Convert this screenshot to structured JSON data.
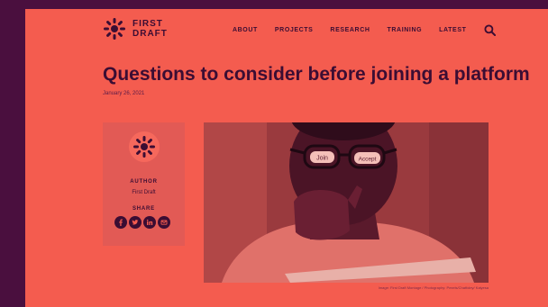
{
  "brand": {
    "name": "FIRST DRAFT",
    "line1": "FIRST",
    "line2": "DRAFT"
  },
  "nav": {
    "items": [
      "ABOUT",
      "PROJECTS",
      "RESEARCH",
      "TRAINING",
      "LATEST"
    ],
    "search_icon": "search-icon"
  },
  "article": {
    "title": "Questions to consider before joining a platform",
    "date": "January 26, 2021"
  },
  "author_card": {
    "author_label": "AUTHOR",
    "author_name": "First Draft",
    "share_label": "SHARE",
    "share_icons": [
      "facebook-icon",
      "twitter-icon",
      "linkedin-icon",
      "email-icon"
    ]
  },
  "hero": {
    "glasses_left_text": "Join",
    "glasses_right_text": "Accept",
    "caption": "Image: First Draft Montage / Photography: Pexels/Chatfoley/ Kalyesa"
  },
  "colors": {
    "background": "#4a0f3e",
    "page": "#f45c4f",
    "text_dark": "#3b0d33",
    "card": "#e25a55"
  }
}
